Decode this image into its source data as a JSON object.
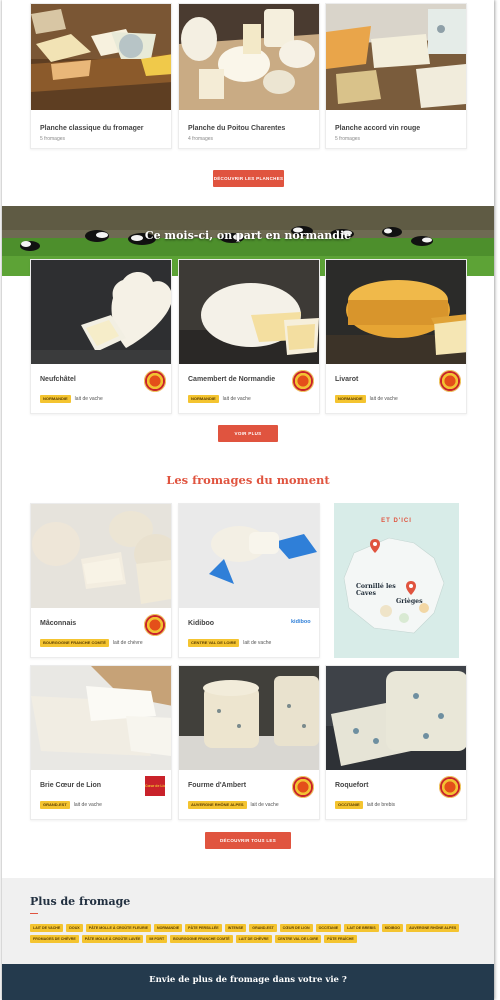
{
  "planches": {
    "items": [
      {
        "title": "Planche classique du fromager",
        "count": "5 fromages"
      },
      {
        "title": "Planche du Poitou Charentes",
        "count": "4 fromages"
      },
      {
        "title": "Planche accord vin rouge",
        "count": "5 fromages"
      }
    ],
    "button": "Découvrir les planches"
  },
  "region": {
    "banner_title": "Ce mois-ci, on part en normandie",
    "items": [
      {
        "title": "Neufchâtel",
        "tag": "Normandie",
        "milk": "lait de vache"
      },
      {
        "title": "Camembert de Normandie",
        "tag": "Normandie",
        "milk": "lait de vache"
      },
      {
        "title": "Livarot",
        "tag": "Normandie",
        "milk": "lait de vache"
      }
    ],
    "button": "Voir plus"
  },
  "moment": {
    "title": "Les fromages du moment",
    "items": [
      {
        "title": "Mâconnais",
        "tag": "Bourgogne Franche Comté",
        "milk": "lait de chèvre"
      },
      {
        "title": "Kidiboo",
        "tag": "Centre Val de Loire",
        "milk": "lait de vache"
      },
      {
        "title": "Brie Cœur de Lion",
        "tag": "Grand-Est",
        "milk": "lait de vache"
      },
      {
        "title": "Fourme d'Ambert",
        "tag": "Auvergne Rhône Alpes",
        "milk": "lait de vache"
      },
      {
        "title": "Roquefort",
        "tag": "Occitanie",
        "milk": "lait de brebis"
      }
    ],
    "ad": {
      "heading": "ET D'ICI",
      "place1": "Cornillé les Caves",
      "place2": "Grièges"
    },
    "kidiboo_logo": "kidiboo",
    "coeur_logo": "Cœur de Lion",
    "button": "Découvrir tous les fromages"
  },
  "more": {
    "title": "Plus de fromage",
    "tags": [
      "Lait de vache",
      "Doux",
      "Pâte molle à croûte fleurie",
      "Normandie",
      "Pâte persillée",
      "Intense",
      "Grand-Est",
      "Cœur de Lion",
      "Occitanie",
      "Lait de brebis",
      "Kidiboo",
      "Auvergne Rhône Alpes",
      "Fromages de chèvre",
      "Pâte molle à croûte lavée",
      "Im Fort",
      "Bourgogne Franche Comté",
      "Lait de chèvre",
      "Centre Val de Loire",
      "Pâte fraîche"
    ]
  },
  "footer": {
    "title": "Envie de plus de fromage dans votre vie ?"
  },
  "colors": {
    "accent": "#e0543f",
    "tag": "#f4c430",
    "footer": "#243a4d"
  }
}
